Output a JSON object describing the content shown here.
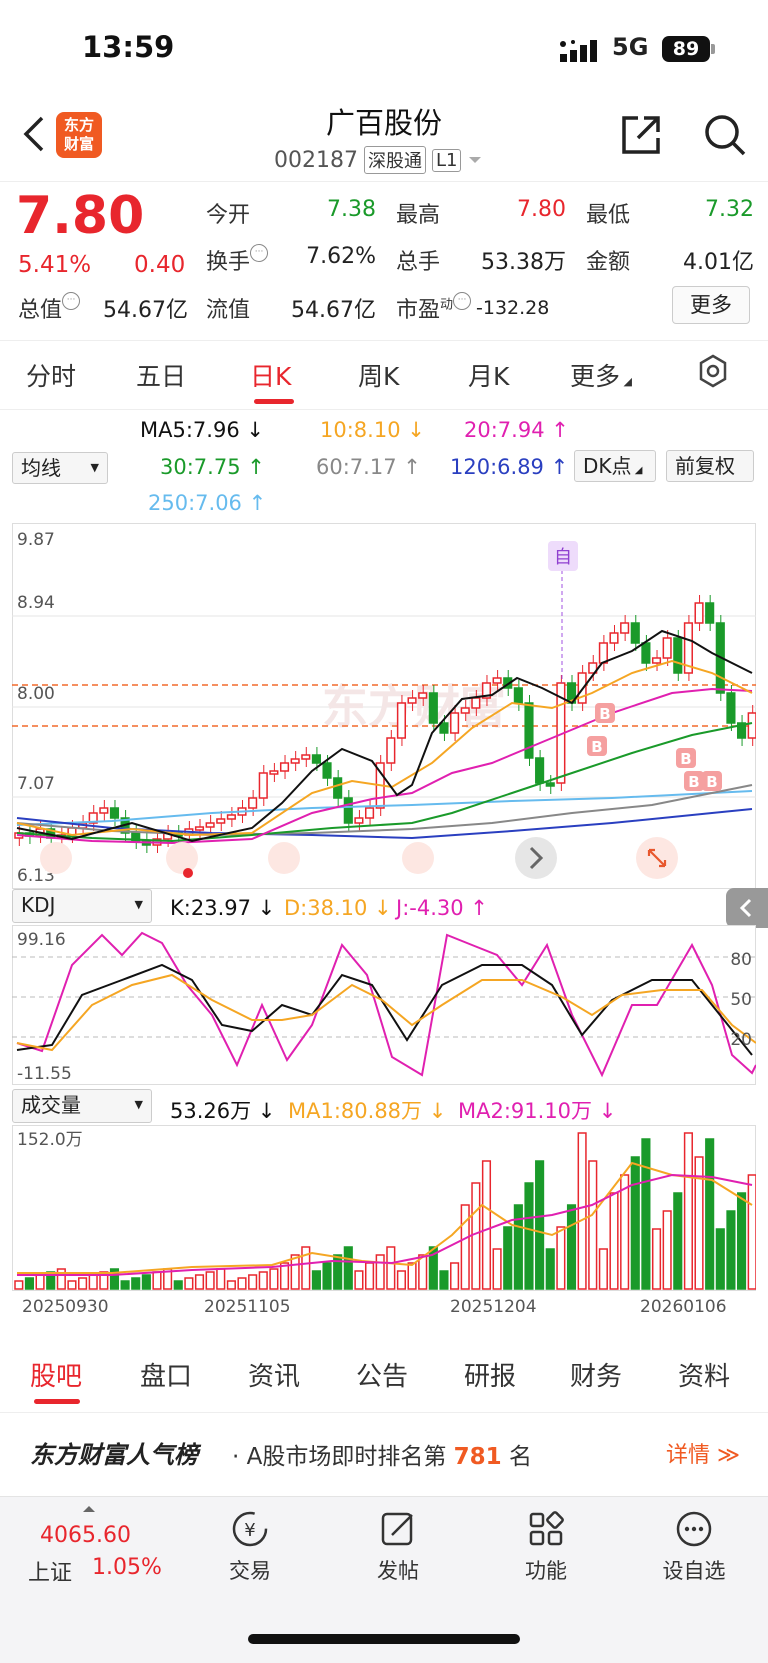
{
  "status": {
    "time": "13:59",
    "network": "5G",
    "battery": "89"
  },
  "header": {
    "logo_line1": "东方",
    "logo_line2": "财富",
    "name": "广百股份",
    "code": "002187",
    "tag1": "深股通",
    "tag2": "L1"
  },
  "quote": {
    "price": "7.80",
    "pct": "5.41%",
    "change": "0.40",
    "open_label": "今开",
    "open": "7.38",
    "high_label": "最高",
    "high": "7.80",
    "low_label": "最低",
    "low": "7.32",
    "turnover_label": "换手",
    "turnover": "7.62%",
    "volume_label": "总手",
    "volume": "53.38万",
    "amount_label": "金额",
    "amount": "4.01亿",
    "mktcap_label": "总值",
    "mktcap": "54.67亿",
    "float_label": "流值",
    "float": "54.67亿",
    "pe_label": "市盈",
    "pe_sup": "动",
    "pe": "-132.28",
    "more": "更多"
  },
  "tabs": [
    "分时",
    "五日",
    "日K",
    "周K",
    "月K",
    "更多"
  ],
  "ma": {
    "ma5": "MA5:7.96 ↓",
    "ma10": "10:8.10 ↓",
    "ma20": "20:7.94 ↑",
    "ma30": "30:7.75 ↑",
    "ma60": "60:7.17 ↑",
    "ma120": "120:6.89 ↑",
    "ma250": "250:7.06 ↑",
    "select": "均线",
    "dk": "DK点",
    "fq": "前复权"
  },
  "colors": {
    "ma5": "#111111",
    "ma10": "#f5a623",
    "ma20": "#e020b0",
    "ma30": "#1a9a2a",
    "ma60": "#888888",
    "ma120": "#2a3fc0",
    "ma250": "#66bbee",
    "up": "#e8262d",
    "down": "#1a9a2a"
  },
  "kchart": {
    "y_labels": [
      "9.87",
      "8.94",
      "8.00",
      "7.07",
      "6.13"
    ],
    "watermark": "东方财富",
    "marker": "自",
    "buy_marks": [
      "B",
      "B",
      "B",
      "B",
      "B"
    ]
  },
  "kdj": {
    "select": "KDJ",
    "k": "K:23.97 ↓",
    "d": "D:38.10 ↓",
    "j": "J:-4.30 ↑",
    "y_top": "99.16",
    "y_bottom": "-11.55",
    "levels": [
      "80",
      "50",
      "20"
    ]
  },
  "vol": {
    "select": "成交量",
    "v": "53.26万 ↓",
    "ma1": "MA1:80.88万 ↓",
    "ma2": "MA2:91.10万 ↓",
    "y_top": "152.0万"
  },
  "dates": [
    "20250930",
    "20251105",
    "20251204",
    "20260106"
  ],
  "subtabs": [
    "股吧",
    "盘口",
    "资讯",
    "公告",
    "研报",
    "财务",
    "资料"
  ],
  "rank": {
    "brand": "东方财富人气榜",
    "text_pre": "· A股市场即时排名第",
    "rank": "781",
    "text_post": "名",
    "detail": "详情 ≫"
  },
  "footer": {
    "index_value": "4065.60",
    "index_name": "上证",
    "index_pct": "1.05%",
    "trade": "交易",
    "post": "发帖",
    "func": "功能",
    "watch": "设自选"
  }
}
